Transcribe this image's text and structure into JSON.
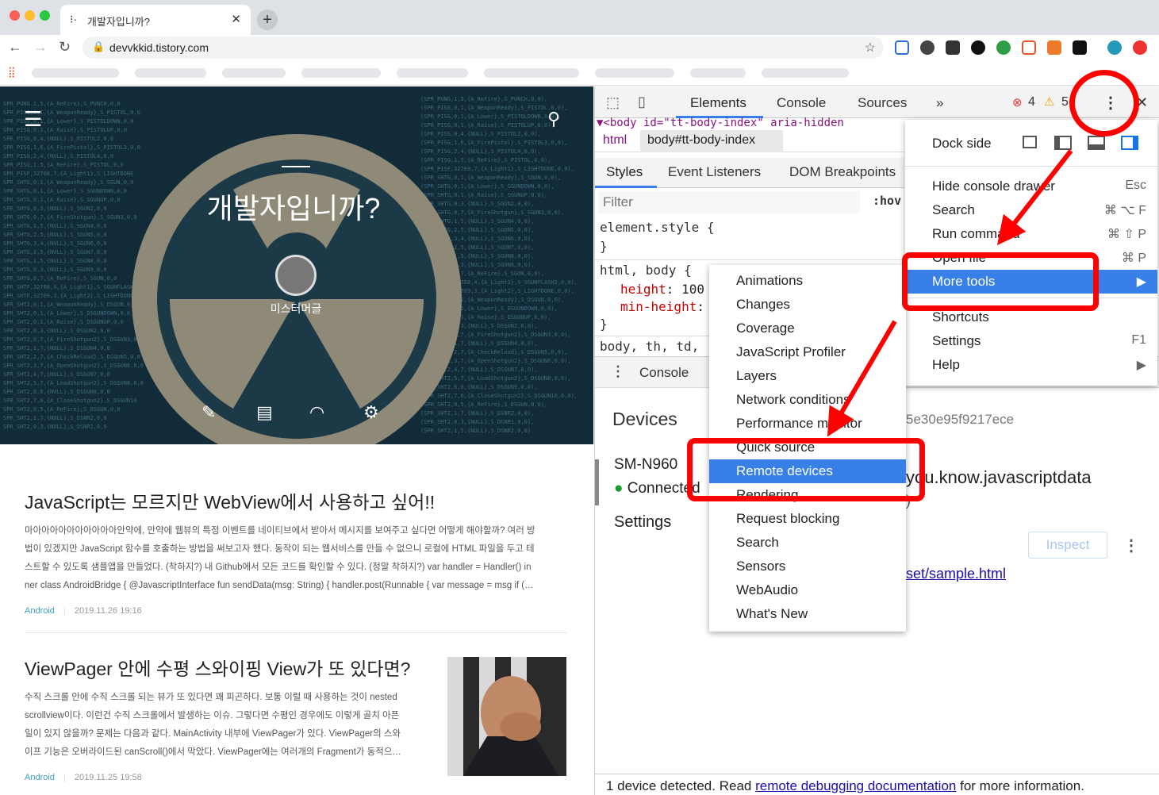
{
  "tab": {
    "title": "개발자입니까?"
  },
  "address": {
    "url": "devvkkid.tistory.com"
  },
  "blog": {
    "title": "개발자입니까?",
    "owner": "미스터머글"
  },
  "posts": [
    {
      "title": "JavaScript는 모르지만 WebView에서 사용하고 싶어!!",
      "lines": [
        "마아아아아아아아아아아안약에, 만약에 웹뷰의 특정 이벤트를 네이티브에서 받아서 메시지를 보여주고 싶다면 어떻게 해야할까? 여러 방",
        "법이 있겠지만 JavaScript 함수를 호출하는 방법을 써보고자 했다. 동작이 되는 웹서비스를 만들 수 없으니 로컬에 HTML 파일을 두고 테",
        "스트할 수 있도록 샘플앱을 만들었다. (착하지?) 내 Github에서 모든 코드를 확인할 수 있다. (정말 착하지?) var handler = Handler() in",
        "ner class AndroidBridge { @JavascriptInterface fun sendData(msg: String) { handler.post(Runnable { var message = msg if (…"
      ],
      "category": "Android",
      "date": "2019.11.26 19:16"
    },
    {
      "title": "ViewPager 안에 수평 스와이핑 View가 또 있다면?",
      "lines": [
        "수직 스크롤 안에 수직 스크롤 되는 뷰가 또 있다면 꽤 피곤하다. 보통 이럴 때 사용하는 것이 nested",
        "scrollview이다. 이런건 수직 스크롤에서 발생하는 이슈. 그렇다면 수평인 경우에도 이렇게 골치 아픈",
        "일이 있지 않을까? 문제는 다음과 같다. MainActivity 내부에 ViewPager가 있다. ViewPager의 스와",
        "이프 기능은 오버라이드된 canScroll()에서 막았다. ViewPager에는 여러개의 Fragment가 동적으…"
      ],
      "category": "Android",
      "date": "2019.11.25 19:58"
    }
  ],
  "devtools": {
    "tabs": [
      "Elements",
      "Console",
      "Sources",
      "»"
    ],
    "errors": "4",
    "warnings": "5",
    "dom_line": "▼<body id=\"tt-body-index\" aria-hidden",
    "crumbs": [
      "html",
      "body#tt-body-index"
    ],
    "subtabs": [
      "Styles",
      "Event Listeners",
      "DOM Breakpoints"
    ],
    "filter_placeholder": "Filter",
    "hov": ":hov",
    "css": {
      "element_style": "element.style {",
      "close1": "}",
      "rule_selector": "html, body {",
      "prop1_name": "height",
      "prop1_value": ": 100",
      "prop2_name": "min-height",
      "prop2_value": ":",
      "close2": "}",
      "rule3": "body, th, td,"
    },
    "drawer_tab": "Console",
    "devices": {
      "heading": "Devices",
      "device_name": "SM-N960",
      "status": "Connected",
      "settings": "Settings",
      "id_fragment": "5e30e95f9217ece",
      "page_fragment": "you.know.javascriptdata",
      "paren": ")",
      "inspect": "Inspect",
      "link": "set/sample.html"
    },
    "footer": {
      "pre": "1 device detected. Read ",
      "link": "remote debugging documentation",
      "post": " for more information."
    }
  },
  "main_menu": {
    "dock_side": "Dock side",
    "items": [
      {
        "label": "Hide console drawer",
        "key": "Esc"
      },
      {
        "label": "Search",
        "key": "⌘ ⌥ F"
      },
      {
        "label": "Run command",
        "key": "⌘ ⇧ P"
      },
      {
        "label": "Open file",
        "key": "⌘ P"
      },
      {
        "label": "More tools",
        "key": "▶"
      },
      {
        "label": "Shortcuts",
        "key": ""
      },
      {
        "label": "Settings",
        "key": "F1"
      },
      {
        "label": "Help",
        "key": "▶"
      }
    ]
  },
  "more_tools_menu": {
    "items": [
      "Animations",
      "Changes",
      "Coverage",
      "JavaScript Profiler",
      "Layers",
      "Network conditions",
      "Performance monitor",
      "Quick source",
      "Remote devices",
      "Rendering",
      "Request blocking",
      "Search",
      "Sensors",
      "WebAudio",
      "What's New"
    ],
    "selected": "Remote devices"
  },
  "colors": {
    "annotation": "#ff0000",
    "selection": "#3880e8",
    "link": "#1a0dab",
    "category": "#3aa0c9"
  }
}
